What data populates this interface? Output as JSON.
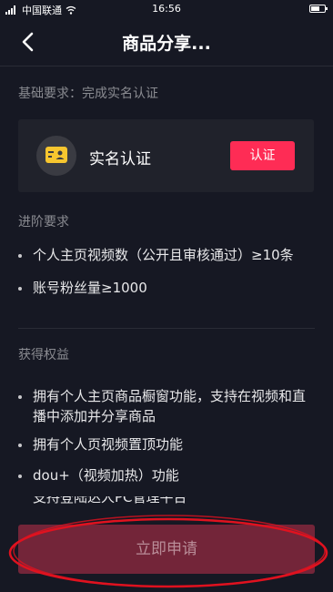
{
  "status_bar": {
    "carrier": "中国联通",
    "time": "16:56"
  },
  "nav": {
    "title": "商品分享..."
  },
  "basic_requirement": "基础要求：完成实名认证",
  "verify_card": {
    "label": "实名认证",
    "button_label": "认证"
  },
  "advanced": {
    "heading": "进阶要求",
    "items": [
      "个人主页视频数（公开且审核通过）≥10条",
      "账号粉丝量≥1000"
    ]
  },
  "benefits": {
    "heading": "获得权益",
    "items": [
      "拥有个人主页商品橱窗功能，支持在视频和直播中添加并分享商品",
      "拥有个人页视频置顶功能",
      "dou+（视频加热）功能",
      "支持登陆达人PC管理平台"
    ]
  },
  "apply_button_label": "立即申请",
  "colors": {
    "background": "#161823",
    "card": "#20222b",
    "accent": "#fe2c55",
    "apply_button": "#732539",
    "annotation": "#e0121f"
  },
  "icons": {
    "signal": "signal-icon",
    "wifi": "wifi-icon",
    "battery": "battery-icon",
    "back": "back-icon",
    "id_card": "id-card-icon"
  }
}
